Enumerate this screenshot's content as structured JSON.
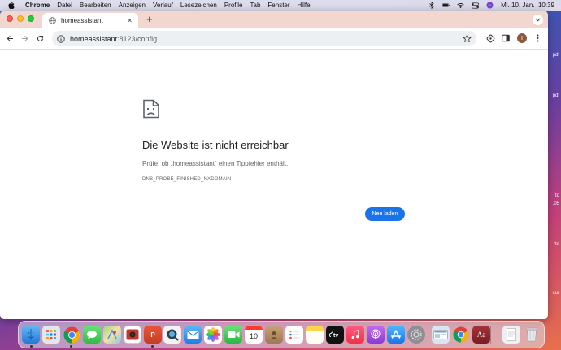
{
  "menubar": {
    "app": "Chrome",
    "items": [
      "Datei",
      "Bearbeiten",
      "Anzeigen",
      "Verlauf",
      "Lesezeichen",
      "Profile",
      "Tab",
      "Fenster",
      "Hilfe"
    ],
    "datetime": "Mi. 10. Jan.  10:39"
  },
  "desktop": {
    "labels": [
      "pdf",
      "pdf",
      "to",
      ".05",
      "rte",
      "cur"
    ]
  },
  "tab": {
    "title": "homeassistant",
    "new_tab": "+"
  },
  "toolbar": {
    "url_host": "homeassistant",
    "url_path": ":8123/config",
    "avatar_letter": "I"
  },
  "error": {
    "title": "Die Website ist nicht erreichbar",
    "subtitle": "Prüfe, ob „homeassistant“ einen Tippfehler enthält.",
    "code": "DNS_PROBE_FINISHED_NXDOMAIN",
    "reload_label": "Neu laden"
  },
  "dock": {
    "calendar_day": "10",
    "dictionary_label": "Aa"
  },
  "colors": {
    "accent": "#1a73e8",
    "tabstrip": "#f2d7d0",
    "omnibox": "#edf0f2"
  }
}
